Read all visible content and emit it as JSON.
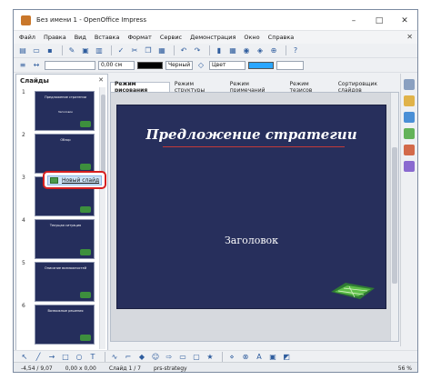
{
  "window": {
    "title": "Без имени 1 - OpenOffice Impress",
    "controls": [
      "–",
      "□",
      "✕"
    ]
  },
  "menu": [
    "Файл",
    "Правка",
    "Вид",
    "Вставка",
    "Формат",
    "Сервис",
    "Демонстрация",
    "Окно",
    "Справка"
  ],
  "toolbar2": {
    "line_width": "0,00 см",
    "line_color": "Черный",
    "fill_mode": "Цвет"
  },
  "slides_panel": {
    "title": "Слайды",
    "thumbs": [
      {
        "num": "1",
        "title": "Предложение стратегии",
        "sub": "Заголовок"
      },
      {
        "num": "2",
        "title": "Обзор",
        "sub": ""
      },
      {
        "num": "3",
        "title": "",
        "sub": ""
      },
      {
        "num": "4",
        "title": "Текущая ситуация",
        "sub": ""
      },
      {
        "num": "5",
        "title": "Описание возможностей",
        "sub": ""
      },
      {
        "num": "6",
        "title": "Возможные решения",
        "sub": ""
      }
    ]
  },
  "context_menu": {
    "new_slide": "Новый слайд"
  },
  "tabs": [
    "Режим рисования",
    "Режим структуры",
    "Режим примечаний",
    "Режим тезисов",
    "Сортировщик слайдов"
  ],
  "slide": {
    "title": "Предложение стратегии",
    "subtitle": "Заголовок"
  },
  "status": {
    "position": "-4,54 / 9,07",
    "size": "0,00 x 0,00",
    "slide": "Слайд 1 / 7",
    "layout": "prs-strategy",
    "zoom": "56 %"
  }
}
